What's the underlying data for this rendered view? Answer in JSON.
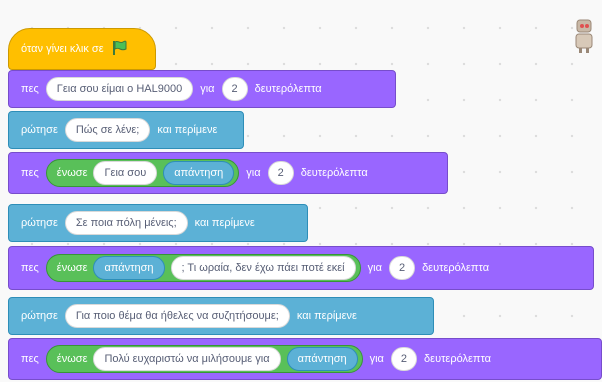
{
  "colors": {
    "looks": "#9966ff",
    "sensing": "#5cb1d6",
    "operators": "#59c059",
    "events": "#ffbf00"
  },
  "blocks": [
    {
      "type": "event",
      "label": "όταν γίνει κλικ σε",
      "icon": "green-flag-icon"
    },
    {
      "type": "say",
      "cmd": "πες",
      "text": "Γεια σου είμαι ο HAL9000",
      "for": "για",
      "secs": "2",
      "unit": "δευτερόλεπτα"
    },
    {
      "type": "ask",
      "cmd": "ρώτησε",
      "question": "Πώς σε λένε;",
      "wait": "και περίμενε"
    },
    {
      "type": "say_join",
      "cmd": "πες",
      "join": "ένωσε",
      "a": "Γεια σου",
      "b": "απάντηση",
      "for": "για",
      "secs": "2",
      "unit": "δευτερόλεπτα"
    },
    {
      "type": "ask",
      "cmd": "ρώτησε",
      "question": "Σε ποια πόλη μένεις;",
      "wait": "και περίμενε"
    },
    {
      "type": "say_join",
      "cmd": "πες",
      "join": "ένωσε",
      "a": "απάντηση",
      "b": "; Τι ωραία, δεν έχω πάει ποτέ εκεί",
      "for": "για",
      "secs": "2",
      "unit": "δευτερόλεπτα"
    },
    {
      "type": "ask",
      "cmd": "ρώτησε",
      "question": "Για ποιο θέμα θα ήθελες να συζητήσουμε;",
      "wait": "και περίμενε"
    },
    {
      "type": "say_join",
      "cmd": "πες",
      "join": "ένωσε",
      "a": "Πολύ ευχαριστώ να μιλήσουμε για",
      "b": "απάντηση",
      "for": "για",
      "secs": "2",
      "unit": "δευτερόλεπτα"
    }
  ]
}
